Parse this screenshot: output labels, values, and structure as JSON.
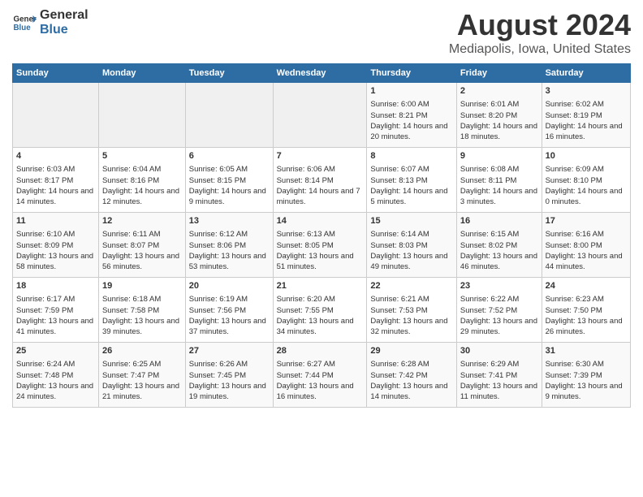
{
  "header": {
    "logo_line1": "General",
    "logo_line2": "Blue",
    "main_title": "August 2024",
    "subtitle": "Mediapolis, Iowa, United States"
  },
  "days_of_week": [
    "Sunday",
    "Monday",
    "Tuesday",
    "Wednesday",
    "Thursday",
    "Friday",
    "Saturday"
  ],
  "weeks": [
    [
      {
        "day": "",
        "empty": true
      },
      {
        "day": "",
        "empty": true
      },
      {
        "day": "",
        "empty": true
      },
      {
        "day": "",
        "empty": true
      },
      {
        "day": "1",
        "sunrise": "Sunrise: 6:00 AM",
        "sunset": "Sunset: 8:21 PM",
        "daylight": "Daylight: 14 hours and 20 minutes."
      },
      {
        "day": "2",
        "sunrise": "Sunrise: 6:01 AM",
        "sunset": "Sunset: 8:20 PM",
        "daylight": "Daylight: 14 hours and 18 minutes."
      },
      {
        "day": "3",
        "sunrise": "Sunrise: 6:02 AM",
        "sunset": "Sunset: 8:19 PM",
        "daylight": "Daylight: 14 hours and 16 minutes."
      }
    ],
    [
      {
        "day": "4",
        "sunrise": "Sunrise: 6:03 AM",
        "sunset": "Sunset: 8:17 PM",
        "daylight": "Daylight: 14 hours and 14 minutes."
      },
      {
        "day": "5",
        "sunrise": "Sunrise: 6:04 AM",
        "sunset": "Sunset: 8:16 PM",
        "daylight": "Daylight: 14 hours and 12 minutes."
      },
      {
        "day": "6",
        "sunrise": "Sunrise: 6:05 AM",
        "sunset": "Sunset: 8:15 PM",
        "daylight": "Daylight: 14 hours and 9 minutes."
      },
      {
        "day": "7",
        "sunrise": "Sunrise: 6:06 AM",
        "sunset": "Sunset: 8:14 PM",
        "daylight": "Daylight: 14 hours and 7 minutes."
      },
      {
        "day": "8",
        "sunrise": "Sunrise: 6:07 AM",
        "sunset": "Sunset: 8:13 PM",
        "daylight": "Daylight: 14 hours and 5 minutes."
      },
      {
        "day": "9",
        "sunrise": "Sunrise: 6:08 AM",
        "sunset": "Sunset: 8:11 PM",
        "daylight": "Daylight: 14 hours and 3 minutes."
      },
      {
        "day": "10",
        "sunrise": "Sunrise: 6:09 AM",
        "sunset": "Sunset: 8:10 PM",
        "daylight": "Daylight: 14 hours and 0 minutes."
      }
    ],
    [
      {
        "day": "11",
        "sunrise": "Sunrise: 6:10 AM",
        "sunset": "Sunset: 8:09 PM",
        "daylight": "Daylight: 13 hours and 58 minutes."
      },
      {
        "day": "12",
        "sunrise": "Sunrise: 6:11 AM",
        "sunset": "Sunset: 8:07 PM",
        "daylight": "Daylight: 13 hours and 56 minutes."
      },
      {
        "day": "13",
        "sunrise": "Sunrise: 6:12 AM",
        "sunset": "Sunset: 8:06 PM",
        "daylight": "Daylight: 13 hours and 53 minutes."
      },
      {
        "day": "14",
        "sunrise": "Sunrise: 6:13 AM",
        "sunset": "Sunset: 8:05 PM",
        "daylight": "Daylight: 13 hours and 51 minutes."
      },
      {
        "day": "15",
        "sunrise": "Sunrise: 6:14 AM",
        "sunset": "Sunset: 8:03 PM",
        "daylight": "Daylight: 13 hours and 49 minutes."
      },
      {
        "day": "16",
        "sunrise": "Sunrise: 6:15 AM",
        "sunset": "Sunset: 8:02 PM",
        "daylight": "Daylight: 13 hours and 46 minutes."
      },
      {
        "day": "17",
        "sunrise": "Sunrise: 6:16 AM",
        "sunset": "Sunset: 8:00 PM",
        "daylight": "Daylight: 13 hours and 44 minutes."
      }
    ],
    [
      {
        "day": "18",
        "sunrise": "Sunrise: 6:17 AM",
        "sunset": "Sunset: 7:59 PM",
        "daylight": "Daylight: 13 hours and 41 minutes."
      },
      {
        "day": "19",
        "sunrise": "Sunrise: 6:18 AM",
        "sunset": "Sunset: 7:58 PM",
        "daylight": "Daylight: 13 hours and 39 minutes."
      },
      {
        "day": "20",
        "sunrise": "Sunrise: 6:19 AM",
        "sunset": "Sunset: 7:56 PM",
        "daylight": "Daylight: 13 hours and 37 minutes."
      },
      {
        "day": "21",
        "sunrise": "Sunrise: 6:20 AM",
        "sunset": "Sunset: 7:55 PM",
        "daylight": "Daylight: 13 hours and 34 minutes."
      },
      {
        "day": "22",
        "sunrise": "Sunrise: 6:21 AM",
        "sunset": "Sunset: 7:53 PM",
        "daylight": "Daylight: 13 hours and 32 minutes."
      },
      {
        "day": "23",
        "sunrise": "Sunrise: 6:22 AM",
        "sunset": "Sunset: 7:52 PM",
        "daylight": "Daylight: 13 hours and 29 minutes."
      },
      {
        "day": "24",
        "sunrise": "Sunrise: 6:23 AM",
        "sunset": "Sunset: 7:50 PM",
        "daylight": "Daylight: 13 hours and 26 minutes."
      }
    ],
    [
      {
        "day": "25",
        "sunrise": "Sunrise: 6:24 AM",
        "sunset": "Sunset: 7:48 PM",
        "daylight": "Daylight: 13 hours and 24 minutes."
      },
      {
        "day": "26",
        "sunrise": "Sunrise: 6:25 AM",
        "sunset": "Sunset: 7:47 PM",
        "daylight": "Daylight: 13 hours and 21 minutes."
      },
      {
        "day": "27",
        "sunrise": "Sunrise: 6:26 AM",
        "sunset": "Sunset: 7:45 PM",
        "daylight": "Daylight: 13 hours and 19 minutes."
      },
      {
        "day": "28",
        "sunrise": "Sunrise: 6:27 AM",
        "sunset": "Sunset: 7:44 PM",
        "daylight": "Daylight: 13 hours and 16 minutes."
      },
      {
        "day": "29",
        "sunrise": "Sunrise: 6:28 AM",
        "sunset": "Sunset: 7:42 PM",
        "daylight": "Daylight: 13 hours and 14 minutes."
      },
      {
        "day": "30",
        "sunrise": "Sunrise: 6:29 AM",
        "sunset": "Sunset: 7:41 PM",
        "daylight": "Daylight: 13 hours and 11 minutes."
      },
      {
        "day": "31",
        "sunrise": "Sunrise: 6:30 AM",
        "sunset": "Sunset: 7:39 PM",
        "daylight": "Daylight: 13 hours and 9 minutes."
      }
    ]
  ]
}
